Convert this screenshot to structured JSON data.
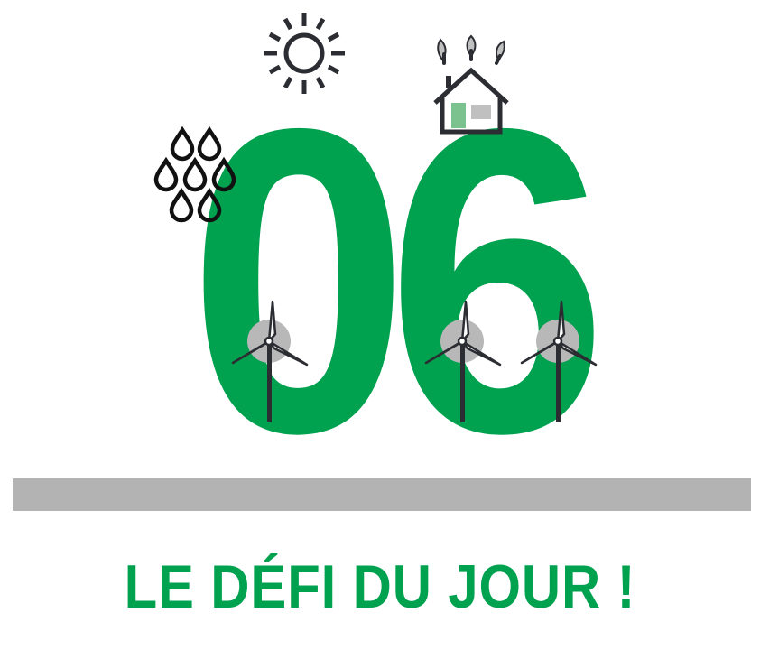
{
  "headline": {
    "number": "06",
    "title": "LE DÉFI DU JOUR !"
  },
  "icons": [
    "sun-icon",
    "rain-drops-icon",
    "house-icon",
    "wind-turbine-icon"
  ],
  "colors": {
    "accent_green": "#00a14f",
    "divider_grey": "#b3b3b3",
    "icon_dark": "#2b2d33",
    "icon_grey": "#c0c0c0",
    "house_window_green": "#7cc28f"
  }
}
